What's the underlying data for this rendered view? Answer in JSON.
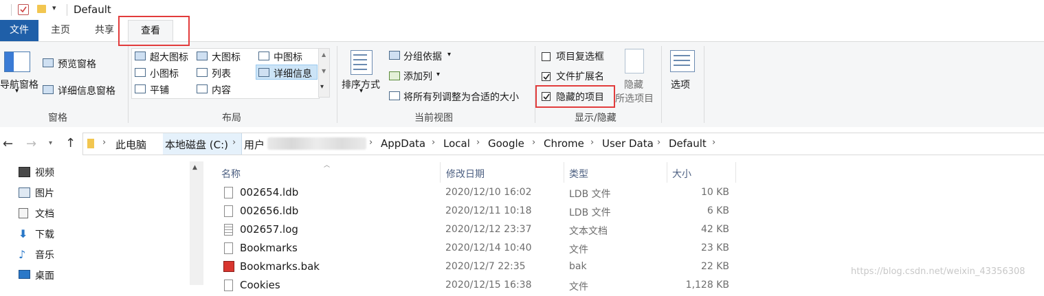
{
  "window": {
    "title": "Default"
  },
  "tabs": {
    "file": "文件",
    "home": "主页",
    "share": "共享",
    "view": "查看"
  },
  "ribbon": {
    "panes": {
      "nav_pane": "导航窗格",
      "preview_pane": "预览窗格",
      "details_pane": "详细信息窗格",
      "group_label": "窗格"
    },
    "layout": {
      "extra_large": "超大图标",
      "large": "大图标",
      "medium": "中图标",
      "small": "小图标",
      "list": "列表",
      "details": "详细信息",
      "tiles": "平铺",
      "content": "内容",
      "group_label": "布局",
      "selected": "详细信息"
    },
    "current_view": {
      "sort_by": "排序方式",
      "group_by": "分组依据",
      "add_column": "添加列",
      "size_all_columns": "将所有列调整为合适的大小",
      "group_label": "当前视图"
    },
    "show_hide": {
      "item_checkboxes": "项目复选框",
      "item_checkboxes_checked": false,
      "file_extensions": "文件扩展名",
      "file_extensions_checked": true,
      "hidden_items": "隐藏的项目",
      "hidden_items_checked": true,
      "hide_selected_line1": "隐藏",
      "hide_selected_line2": "所选项目",
      "group_label": "显示/隐藏"
    },
    "options": "选项"
  },
  "address": {
    "crumbs": [
      "此电脑",
      "本地磁盘 (C:)",
      "用户",
      "AppData",
      "Local",
      "Google",
      "Chrome",
      "User Data",
      "Default"
    ]
  },
  "nav": {
    "items": [
      {
        "label": "视频",
        "icon": "video-icon"
      },
      {
        "label": "图片",
        "icon": "picture-icon"
      },
      {
        "label": "文档",
        "icon": "document-icon"
      },
      {
        "label": "下载",
        "icon": "download-icon"
      },
      {
        "label": "音乐",
        "icon": "music-icon"
      },
      {
        "label": "桌面",
        "icon": "desktop-icon"
      }
    ]
  },
  "filelist": {
    "headers": {
      "name": "名称",
      "modified": "修改日期",
      "type": "类型",
      "size": "大小"
    },
    "rows": [
      {
        "name": "002654.ldb",
        "date": "2020/12/10 16:02",
        "type": "LDB 文件",
        "size": "10 KB"
      },
      {
        "name": "002656.ldb",
        "date": "2020/12/11 10:18",
        "type": "LDB 文件",
        "size": "6 KB"
      },
      {
        "name": "002657.log",
        "date": "2020/12/12 23:37",
        "type": "文本文档",
        "size": "42 KB"
      },
      {
        "name": "Bookmarks",
        "date": "2020/12/14 10:40",
        "type": "文件",
        "size": "23 KB"
      },
      {
        "name": "Bookmarks.bak",
        "date": "2020/12/7 22:35",
        "type": "bak",
        "size": "22 KB"
      },
      {
        "name": "Cookies",
        "date": "2020/12/15 16:38",
        "type": "文件",
        "size": "1,128 KB"
      }
    ]
  },
  "watermark": "https://blog.csdn.net/weixin_43356308"
}
